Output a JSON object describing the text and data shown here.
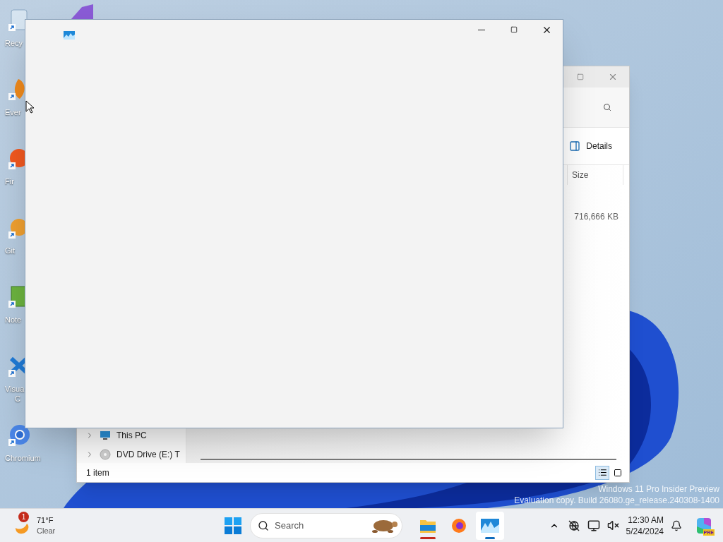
{
  "desktop_icons": [
    {
      "kind": "recycle",
      "lines": [
        "Recy"
      ]
    },
    {
      "kind": "everything",
      "lines": [
        "Ever"
      ]
    },
    {
      "kind": "firefox",
      "lines": [
        "Fir"
      ]
    },
    {
      "kind": "git",
      "lines": [
        "Git"
      ]
    },
    {
      "kind": "notepad",
      "lines": [
        "Note"
      ]
    },
    {
      "kind": "vscode",
      "lines": [
        "Visua",
        "C"
      ]
    },
    {
      "kind": "chromium",
      "lines": [
        "Chromium"
      ]
    }
  ],
  "explorer_window": {
    "details_button": "Details",
    "columns": [
      "Size"
    ],
    "rows": [
      {
        "size": "716,666 KB"
      }
    ],
    "nav_items": [
      {
        "label": "This PC",
        "kind": "pc"
      },
      {
        "label": "DVD Drive (E:) T",
        "kind": "dvd"
      }
    ],
    "status": "1 item",
    "views": [
      {
        "kind": "details",
        "selected": true
      },
      {
        "kind": "tiles",
        "selected": false
      }
    ]
  },
  "watermark": [
    "Windows 11 Pro Insider Preview",
    "Evaluation copy. Build 26080.ge_release.240308-1400"
  ],
  "taskbar": {
    "weather": {
      "badge": "1",
      "temperature": "71°F",
      "condition": "Clear"
    },
    "search": {
      "placeholder": "Search"
    },
    "apps": [
      {
        "kind": "explorer",
        "attention": true,
        "selected": false
      },
      {
        "kind": "firefox",
        "attention": false,
        "selected": false
      },
      {
        "kind": "monitor",
        "attention": false,
        "selected": true
      }
    ],
    "clock": {
      "time": "12:30 AM",
      "date": "5/24/2024"
    },
    "copilot_badge": "PRE"
  }
}
